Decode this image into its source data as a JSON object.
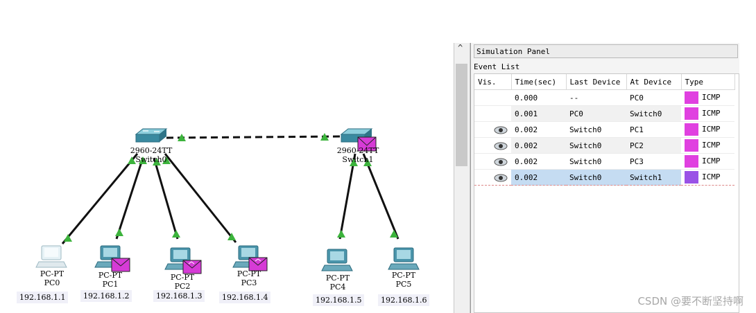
{
  "topology": {
    "switches": [
      {
        "id": "switch0",
        "model": "2960-24TT",
        "name": "Switch0"
      },
      {
        "id": "switch1",
        "model": "2960-24TT",
        "name": "Switch1"
      }
    ],
    "pcs": [
      {
        "type": "PC-PT",
        "name": "PC0",
        "ip": "192.168.1.1",
        "has_envelope": false
      },
      {
        "type": "PC-PT",
        "name": "PC1",
        "ip": "192.168.1.2",
        "has_envelope": true
      },
      {
        "type": "PC-PT",
        "name": "PC2",
        "ip": "192.168.1.3",
        "has_envelope": true
      },
      {
        "type": "PC-PT",
        "name": "PC3",
        "ip": "192.168.1.4",
        "has_envelope": true
      },
      {
        "type": "PC-PT",
        "name": "PC4",
        "ip": "192.168.1.5",
        "has_envelope": false
      },
      {
        "type": "PC-PT",
        "name": "PC5",
        "ip": "192.168.1.6",
        "has_envelope": false
      }
    ]
  },
  "simulation_panel": {
    "title": "Simulation Panel",
    "event_list_label": "Event List",
    "columns": [
      "Vis.",
      "Time(sec)",
      "Last Device",
      "At Device",
      "Type"
    ],
    "rows": [
      {
        "vis": false,
        "time": "0.000",
        "last": "--",
        "at": "PC0",
        "type": "ICMP",
        "color": "#e040e0"
      },
      {
        "vis": false,
        "time": "0.001",
        "last": "PC0",
        "at": "Switch0",
        "type": "ICMP",
        "color": "#e040e0"
      },
      {
        "vis": true,
        "time": "0.002",
        "last": "Switch0",
        "at": "PC1",
        "type": "ICMP",
        "color": "#e040e0"
      },
      {
        "vis": true,
        "time": "0.002",
        "last": "Switch0",
        "at": "PC2",
        "type": "ICMP",
        "color": "#e040e0"
      },
      {
        "vis": true,
        "time": "0.002",
        "last": "Switch0",
        "at": "PC3",
        "type": "ICMP",
        "color": "#e040e0"
      },
      {
        "vis": true,
        "time": "0.002",
        "last": "Switch0",
        "at": "Switch1",
        "type": "ICMP",
        "color": "#9a52e6"
      }
    ]
  },
  "watermark": "CSDN @要不断坚持啊"
}
